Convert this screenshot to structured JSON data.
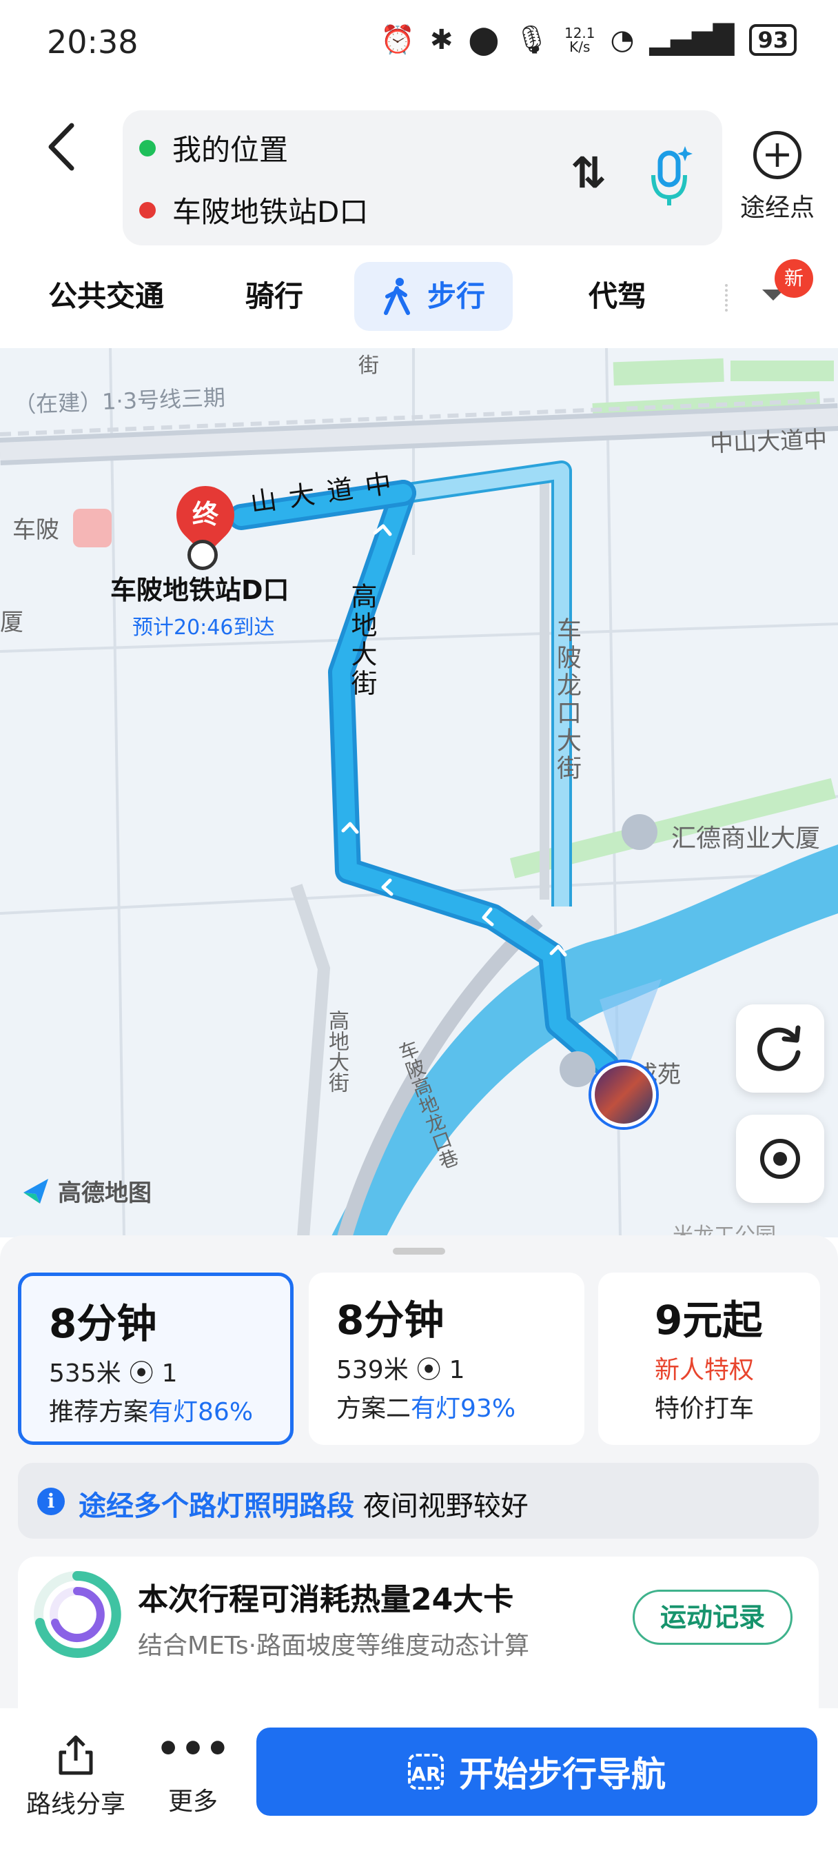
{
  "status_bar": {
    "time": "20:38",
    "net_speed_value": "12.1",
    "net_speed_unit": "K/s",
    "battery": "93"
  },
  "route_input": {
    "origin": "我的位置",
    "destination": "车陂地铁站D口",
    "waypoint_label": "途经点"
  },
  "tabs": [
    {
      "label": "公共交通"
    },
    {
      "label": "骑行"
    },
    {
      "label": "步行",
      "active": true
    },
    {
      "label": "代驾"
    }
  ],
  "new_badge": "新",
  "map": {
    "road_labels": [
      "（在建）1·3号线三期",
      "中山大道中",
      "山大道中",
      "车陂",
      "厦",
      "高地大街",
      "车陂龙口大街",
      "高地大街",
      "车陂高地龙口巷",
      "汇德商业大厦",
      "成苑",
      "街",
      "米龙工公园"
    ],
    "end_marker": "终",
    "destination_label": "车陂地铁站D口",
    "eta_label": "预计20:46到达",
    "logo_text": "高德地图"
  },
  "route_cards": [
    {
      "time": "8分钟",
      "distance": "535米",
      "lights": "1",
      "plan": "推荐方案",
      "light_note": "有灯86%",
      "selected": true
    },
    {
      "time": "8分钟",
      "distance": "539米",
      "lights": "1",
      "plan": "方案二",
      "light_note": "有灯93%",
      "selected": false
    },
    {
      "time": "9元起",
      "promo": "新人特权",
      "plan": "特价打车"
    }
  ],
  "tip": {
    "highlight": "途经多个路灯照明路段",
    "text": "夜间视野较好"
  },
  "calorie": {
    "title": "本次行程可消耗热量24大卡",
    "subtitle": "结合METs·路面坡度等维度动态计算",
    "button": "运动记录"
  },
  "bottom_bar": {
    "share_label": "路线分享",
    "more_label": "更多",
    "nav_button": "开始步行导航",
    "ar_label": "AR"
  },
  "colors": {
    "accent": "#1d6ff2",
    "route": "#29a9e6",
    "origin_dot": "#1fbf5a",
    "dest_dot": "#e53935",
    "promo": "#e8452e",
    "sport": "#17946d"
  }
}
